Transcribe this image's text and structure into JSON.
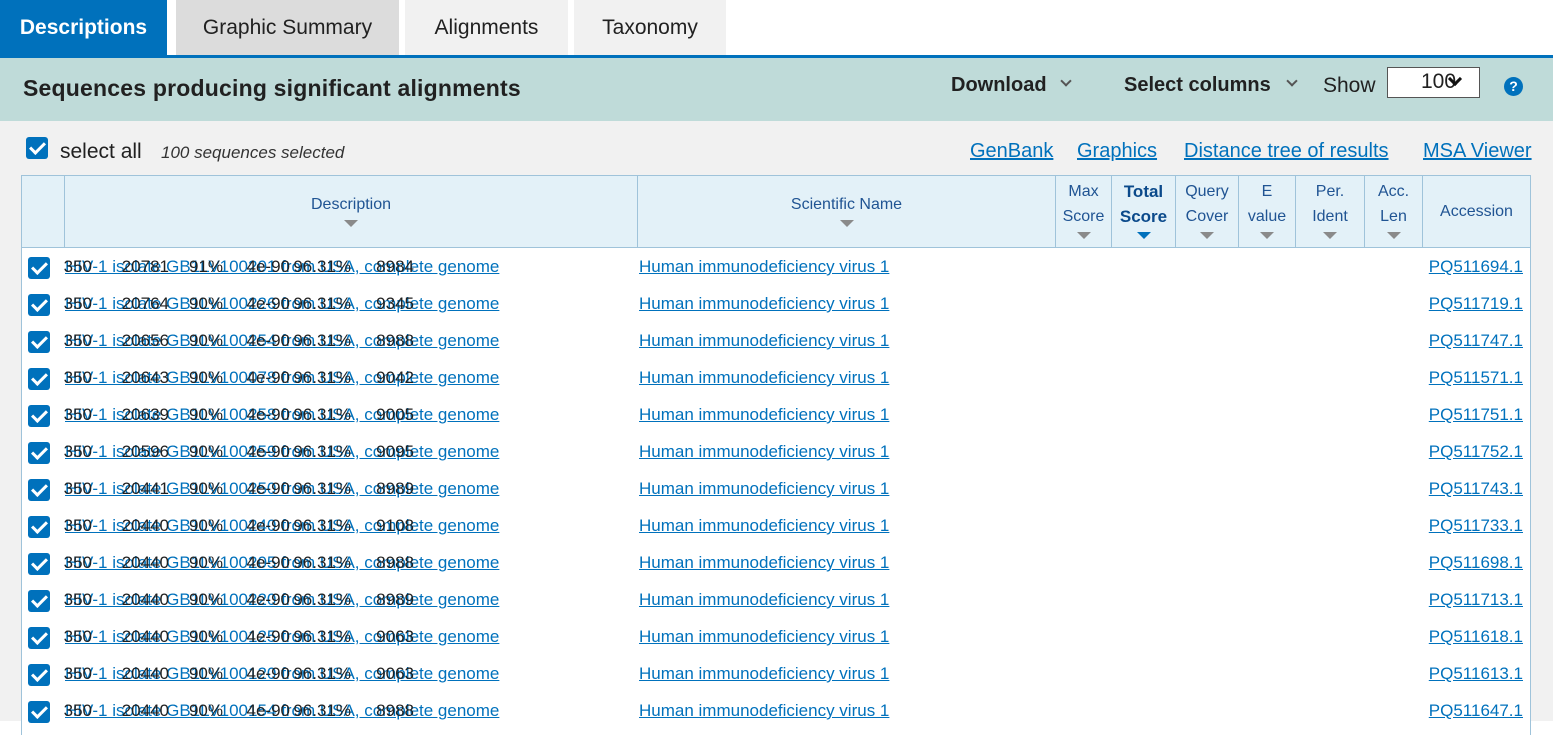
{
  "tabs": [
    {
      "label": "Descriptions",
      "active": true
    },
    {
      "label": "Graphic Summary",
      "active": false
    },
    {
      "label": "Alignments",
      "active": false
    },
    {
      "label": "Taxonomy",
      "active": false
    }
  ],
  "header": {
    "title": "Sequences producing significant alignments",
    "download_label": "Download",
    "select_columns_label": "Select columns",
    "show_label": "Show",
    "show_value": "100",
    "help_glyph": "?"
  },
  "selection": {
    "select_all_label": "select all",
    "count_text": "100 sequences selected"
  },
  "links": [
    "GenBank",
    "Graphics",
    "Distance tree of results",
    "MSA Viewer"
  ],
  "columns": {
    "description": "Description",
    "scientific_name": "Scientific Name",
    "max_score": [
      "Max",
      "Score"
    ],
    "total_score": [
      "Total",
      "Score"
    ],
    "query_cover": [
      "Query",
      "Cover"
    ],
    "e_value": [
      "E",
      "value"
    ],
    "per_ident": [
      "Per.",
      "Ident"
    ],
    "acc_len": [
      "Acc.",
      "Len"
    ],
    "accession": "Accession"
  },
  "rows": [
    {
      "description": "HIV-1 isolate GB1LV100201 from USA, complete genome",
      "scientific_name": "Human immunodeficiency virus 1",
      "max_score": "350",
      "total_score": "20781",
      "query_cover": "91%",
      "e_value": "4e-90",
      "per_ident": "96.31%",
      "acc_len": "8984",
      "accession": "PQ511694.1"
    },
    {
      "description": "HIV-1 isolate GB1LV100226 from USA, complete genome",
      "scientific_name": "Human immunodeficiency virus 1",
      "max_score": "350",
      "total_score": "20764",
      "query_cover": "90%",
      "e_value": "4e-90",
      "per_ident": "96.31%",
      "acc_len": "9345",
      "accession": "PQ511719.1"
    },
    {
      "description": "HIV-1 isolate GB1LV100254 from USA, complete genome",
      "scientific_name": "Human immunodeficiency virus 1",
      "max_score": "350",
      "total_score": "20656",
      "query_cover": "90%",
      "e_value": "4e-90",
      "per_ident": "96.31%",
      "acc_len": "8988",
      "accession": "PQ511747.1"
    },
    {
      "description": "HIV-1 isolate GB1LV100078 from USA, complete genome",
      "scientific_name": "Human immunodeficiency virus 1",
      "max_score": "350",
      "total_score": "20643",
      "query_cover": "90%",
      "e_value": "4e-90",
      "per_ident": "96.31%",
      "acc_len": "9042",
      "accession": "PQ511571.1"
    },
    {
      "description": "HIV-1 isolate GB1LV100258 from USA, complete genome",
      "scientific_name": "Human immunodeficiency virus 1",
      "max_score": "350",
      "total_score": "20639",
      "query_cover": "90%",
      "e_value": "4e-90",
      "per_ident": "96.31%",
      "acc_len": "9005",
      "accession": "PQ511751.1"
    },
    {
      "description": "HIV-1 isolate GB1LV100259 from USA, complete genome",
      "scientific_name": "Human immunodeficiency virus 1",
      "max_score": "350",
      "total_score": "20596",
      "query_cover": "90%",
      "e_value": "4e-90",
      "per_ident": "96.31%",
      "acc_len": "9095",
      "accession": "PQ511752.1"
    },
    {
      "description": "HIV-1 isolate GB1LV100250 from USA, complete genome",
      "scientific_name": "Human immunodeficiency virus 1",
      "max_score": "350",
      "total_score": "20441",
      "query_cover": "90%",
      "e_value": "4e-90",
      "per_ident": "96.31%",
      "acc_len": "8989",
      "accession": "PQ511743.1"
    },
    {
      "description": "HIV-1 isolate GB1LV100240 from USA, complete genome",
      "scientific_name": "Human immunodeficiency virus 1",
      "max_score": "350",
      "total_score": "20440",
      "query_cover": "90%",
      "e_value": "4e-90",
      "per_ident": "96.31%",
      "acc_len": "9108",
      "accession": "PQ511733.1"
    },
    {
      "description": "HIV-1 isolate GB1LV100205 from USA, complete genome",
      "scientific_name": "Human immunodeficiency virus 1",
      "max_score": "350",
      "total_score": "20440",
      "query_cover": "90%",
      "e_value": "4e-90",
      "per_ident": "96.31%",
      "acc_len": "8988",
      "accession": "PQ511698.1"
    },
    {
      "description": "HIV-1 isolate GB1LV100220 from USA, complete genome",
      "scientific_name": "Human immunodeficiency virus 1",
      "max_score": "350",
      "total_score": "20440",
      "query_cover": "90%",
      "e_value": "4e-90",
      "per_ident": "96.31%",
      "acc_len": "8989",
      "accession": "PQ511713.1"
    },
    {
      "description": "HIV-1 isolate GB1LV100125 from USA, complete genome",
      "scientific_name": "Human immunodeficiency virus 1",
      "max_score": "350",
      "total_score": "20440",
      "query_cover": "90%",
      "e_value": "4e-90",
      "per_ident": "96.31%",
      "acc_len": "9063",
      "accession": "PQ511618.1"
    },
    {
      "description": "HIV-1 isolate GB1LV100120 from USA, complete genome",
      "scientific_name": "Human immunodeficiency virus 1",
      "max_score": "350",
      "total_score": "20440",
      "query_cover": "90%",
      "e_value": "4e-90",
      "per_ident": "96.31%",
      "acc_len": "9063",
      "accession": "PQ511613.1"
    },
    {
      "description": "HIV-1 isolate GB1LV100154 from USA, complete genome",
      "scientific_name": "Human immunodeficiency virus 1",
      "max_score": "350",
      "total_score": "20440",
      "query_cover": "90%",
      "e_value": "4e-90",
      "per_ident": "96.31%",
      "acc_len": "8988",
      "accession": "PQ511647.1"
    }
  ]
}
